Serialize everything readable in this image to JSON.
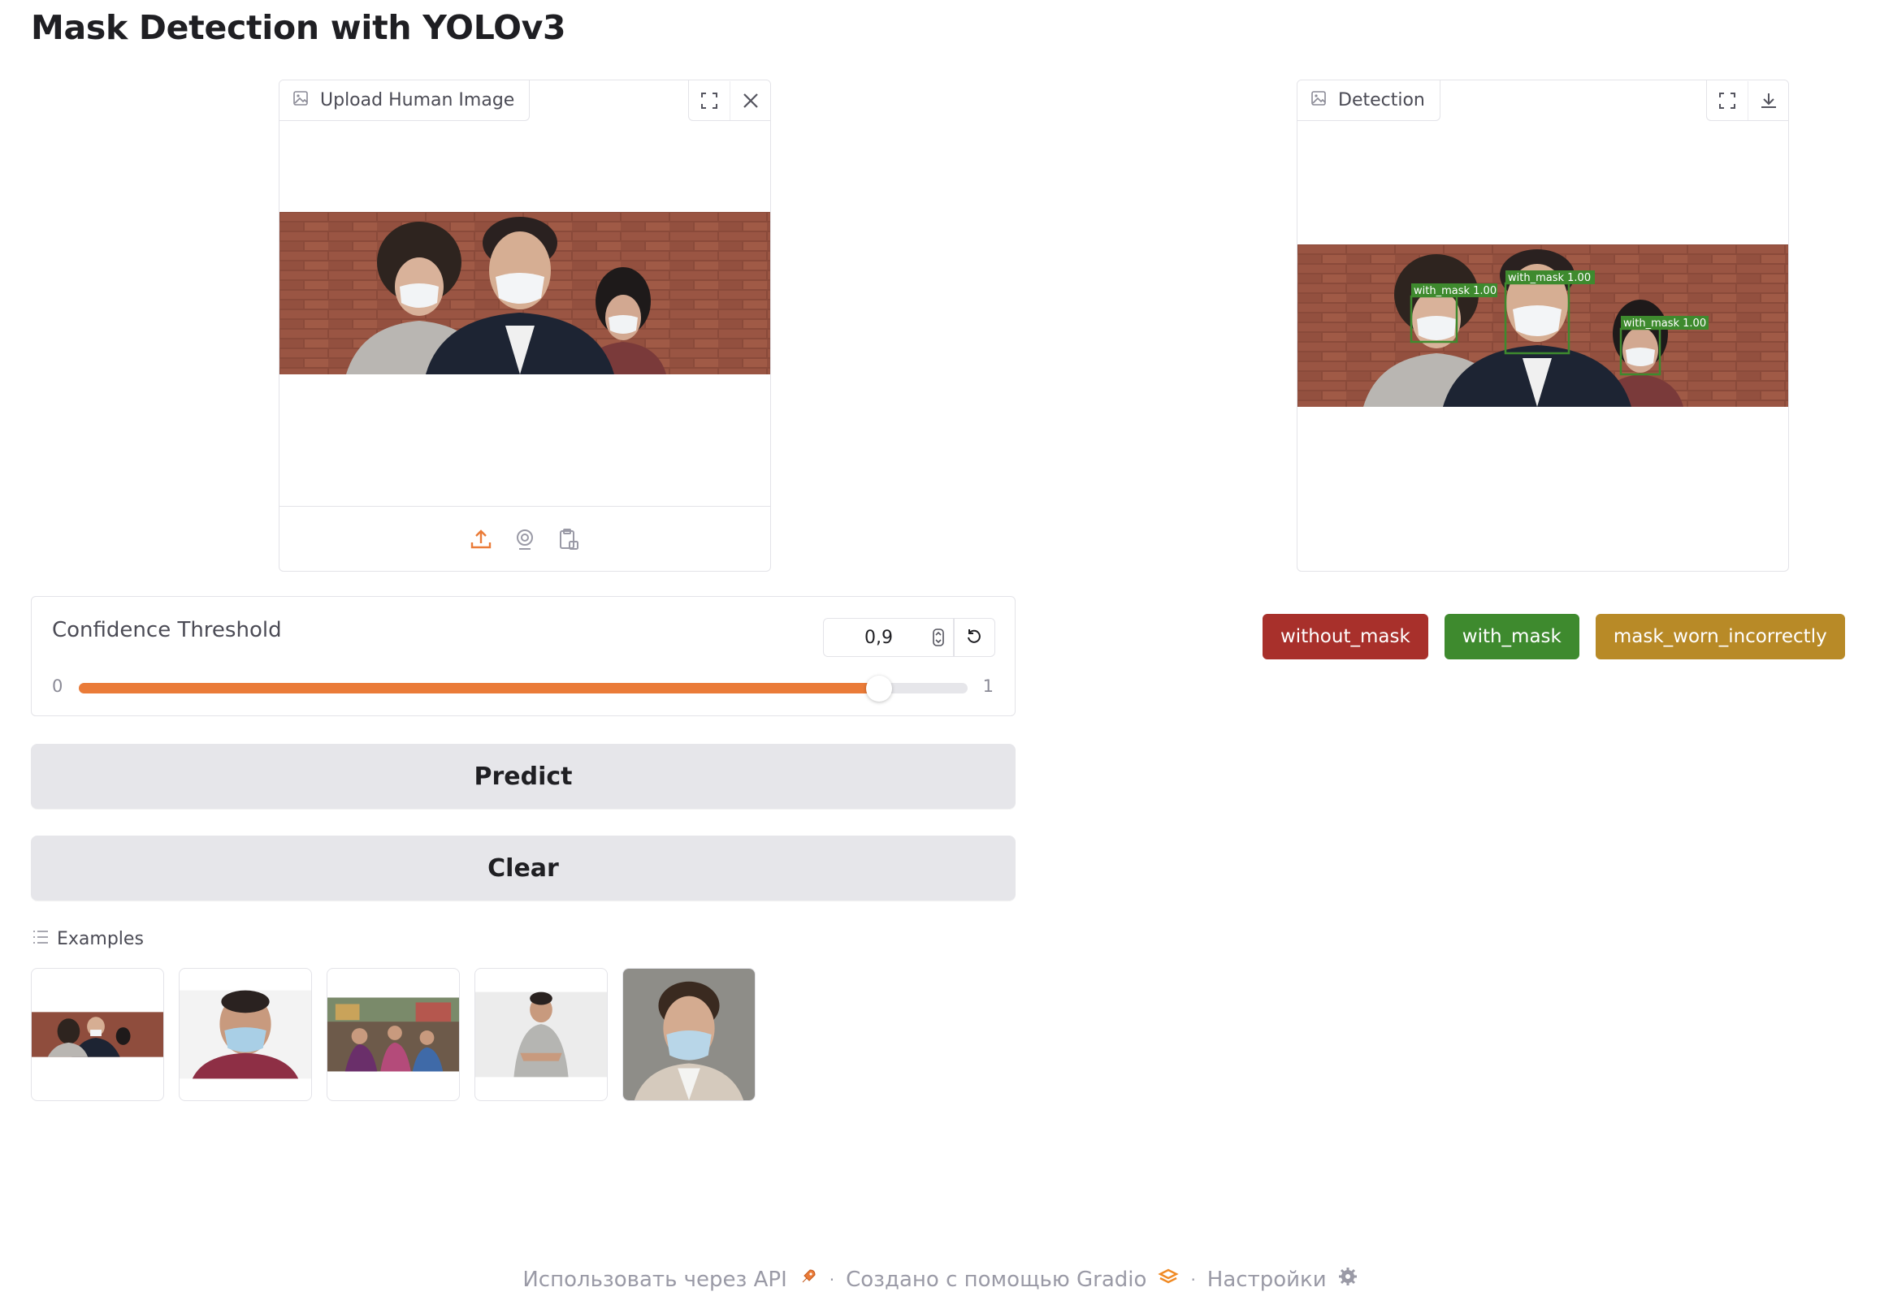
{
  "app_title": "Mask Detection with YOLOv3",
  "input_panel": {
    "label": "Upload Human Image",
    "tools": [
      "fullscreen-icon",
      "close-icon"
    ],
    "upload_sources": [
      "upload-icon",
      "webcam-icon",
      "clipboard-icon"
    ]
  },
  "output_panel": {
    "label": "Detection",
    "tools": [
      "fullscreen-icon",
      "download-icon"
    ],
    "detections": [
      {
        "label": "with_mask 1.00"
      },
      {
        "label": "with_mask 1.00"
      },
      {
        "label": "with_mask 1.00"
      }
    ]
  },
  "slider": {
    "label": "Confidence Threshold",
    "value_text": "0,9",
    "value": 0.9,
    "min": "0",
    "max": "1"
  },
  "buttons": {
    "predict": "Predict",
    "clear": "Clear"
  },
  "examples": {
    "label": "Examples",
    "count": 5
  },
  "legend": [
    {
      "label": "without_mask",
      "color": "#a8302b"
    },
    {
      "label": "with_mask",
      "color": "#3e8a2e"
    },
    {
      "label": "mask_worn_incorrectly",
      "color": "#b88a27"
    }
  ],
  "footer": {
    "api": "Использовать через API",
    "built_with": "Создано с помощью Gradio",
    "settings": "Настройки"
  },
  "colors": {
    "accent": "#ea7b38",
    "box_green": "#3e8a2e"
  }
}
